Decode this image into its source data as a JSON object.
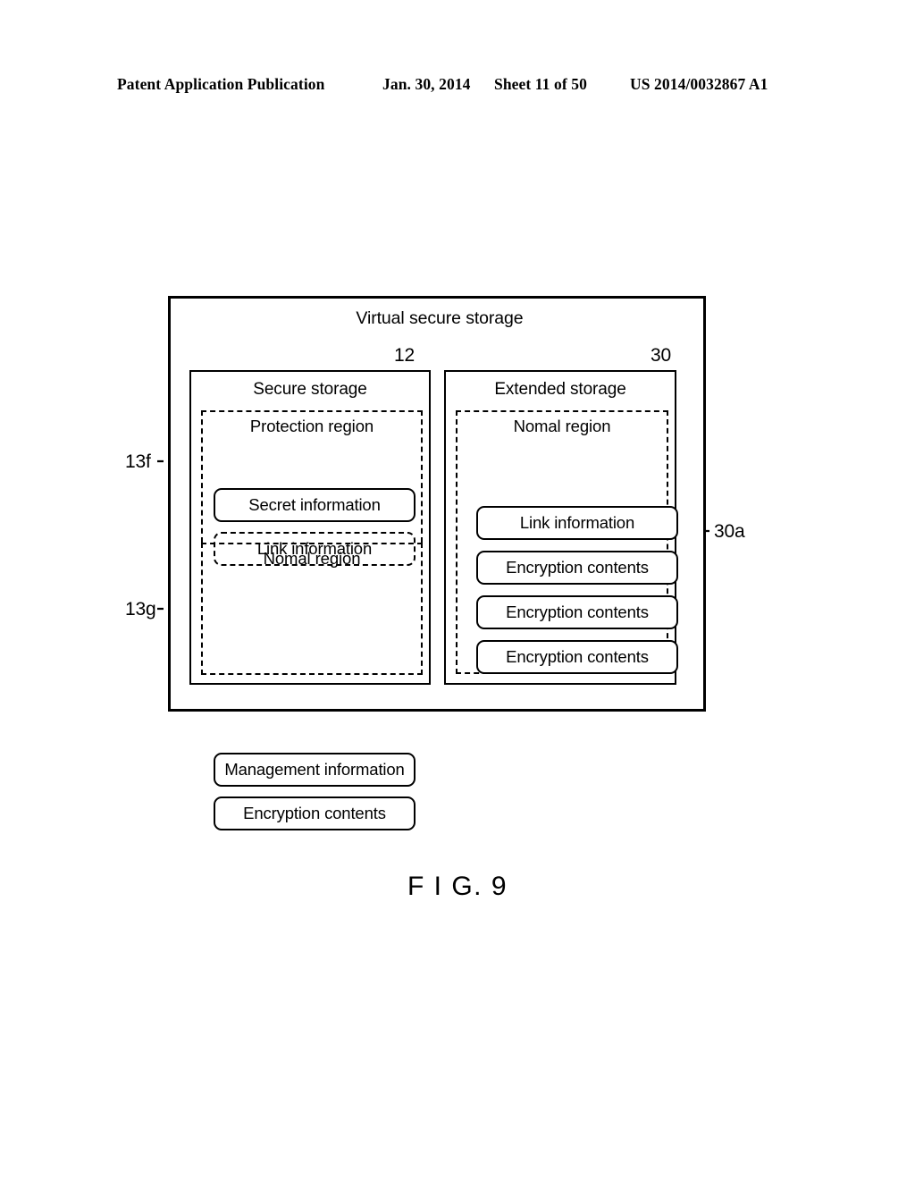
{
  "page_header": {
    "publication": "Patent Application Publication",
    "date": "Jan. 30, 2014",
    "sheet": "Sheet 11 of 50",
    "document_number": "US 2014/0032867 A1"
  },
  "figure": {
    "caption": "F I G. 9",
    "outer_box": {
      "title": "Virtual secure storage"
    },
    "columns": [
      {
        "id": "secure-storage",
        "title": "Secure storage",
        "reference_numeral": "12",
        "regions": [
          {
            "id": "protection-region",
            "title": "Protection region",
            "reference_numeral": "13f",
            "items": [
              {
                "label": "Secret information",
                "border": "solid"
              },
              {
                "label": "Link information",
                "border": "dashed"
              }
            ]
          },
          {
            "id": "nomal-region-left",
            "title": "Nomal region",
            "reference_numeral": "13g",
            "items": [
              {
                "label": "Management information",
                "border": "solid"
              },
              {
                "label": "Encryption contents",
                "border": "solid"
              }
            ]
          }
        ]
      },
      {
        "id": "extended-storage",
        "title": "Extended storage",
        "reference_numeral": "30",
        "regions": [
          {
            "id": "nomal-region-right",
            "title": "Nomal region",
            "reference_numeral": "30a",
            "items": [
              {
                "label": "Link information",
                "border": "solid"
              },
              {
                "label": "Encryption contents",
                "border": "solid"
              },
              {
                "label": "Encryption contents",
                "border": "solid"
              },
              {
                "label": "Encryption contents",
                "border": "solid"
              }
            ]
          }
        ]
      }
    ]
  }
}
